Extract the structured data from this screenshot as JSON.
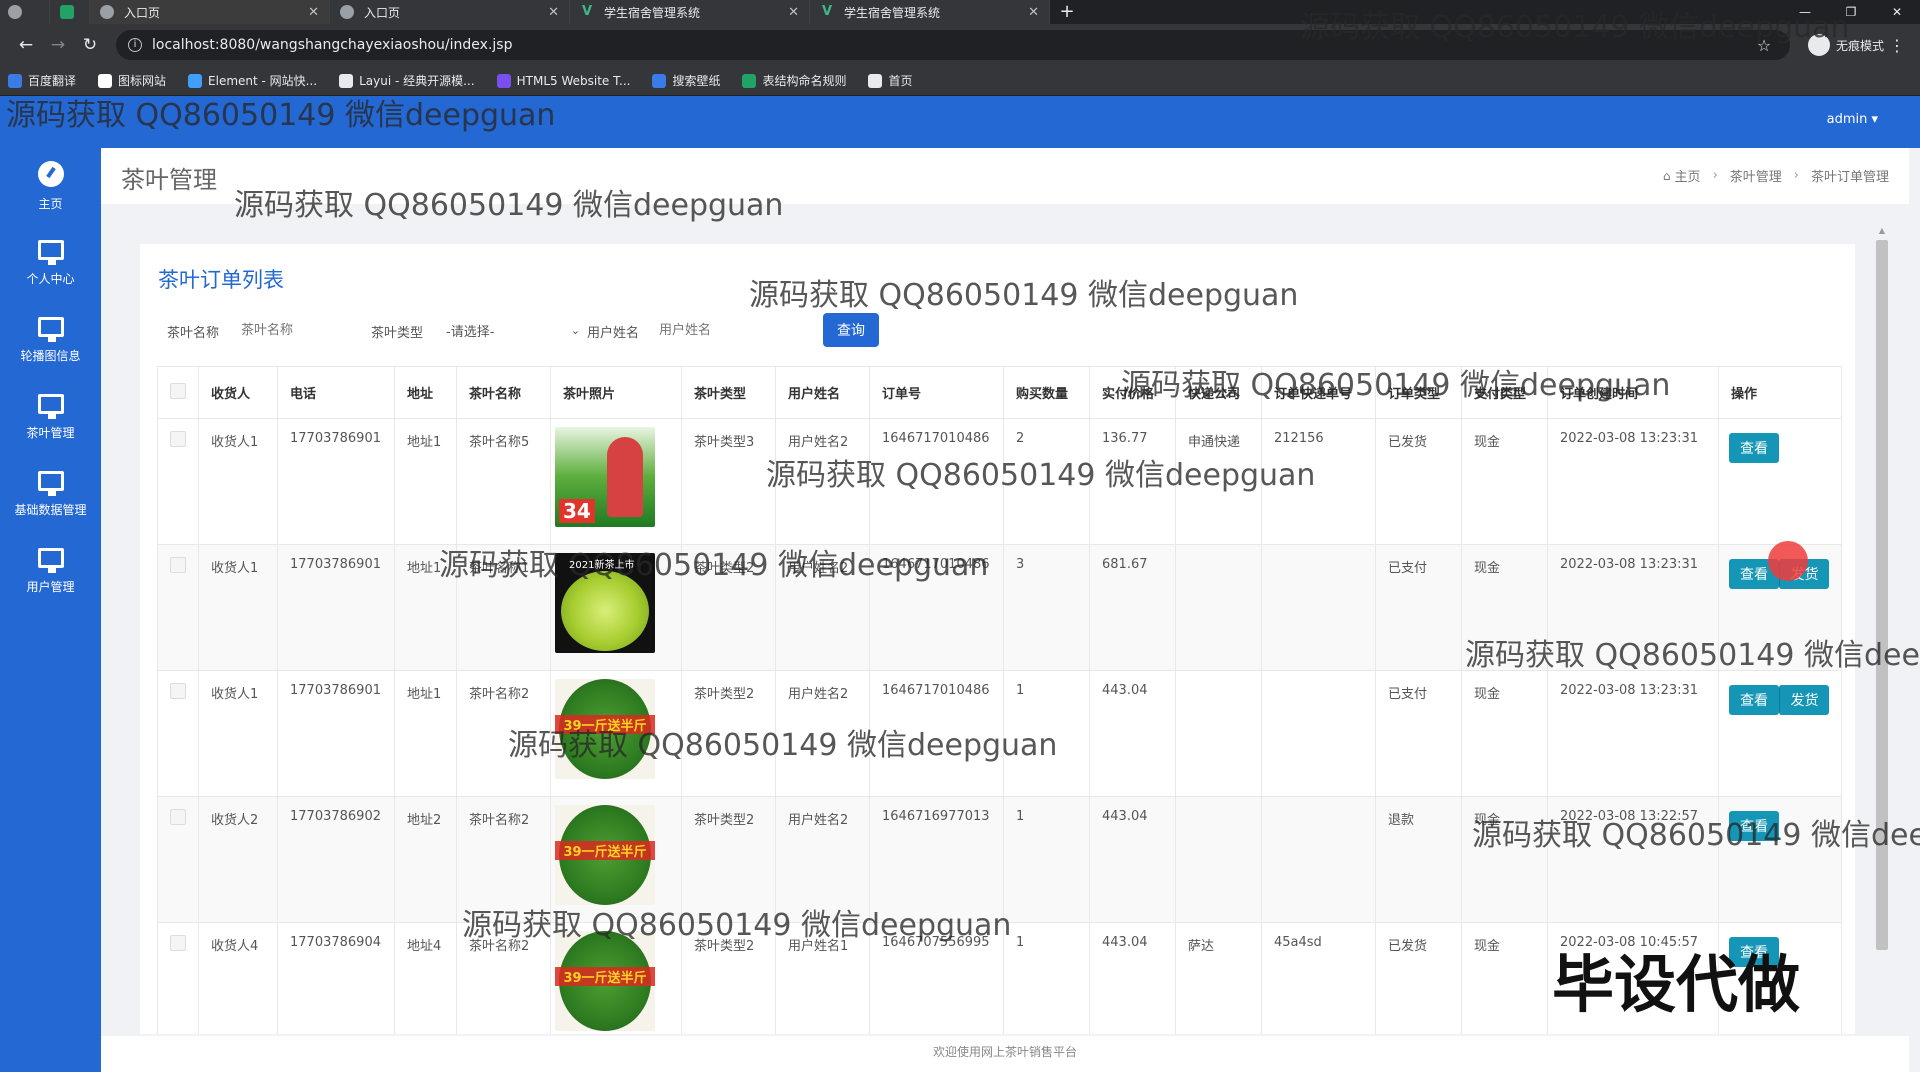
{
  "browser": {
    "tabs": [
      {
        "title": "入口页",
        "active": true,
        "icon": "globe-icon"
      },
      {
        "title": "入口页",
        "active": false,
        "icon": "globe-icon"
      },
      {
        "title": "学生宿舍管理系统",
        "active": false,
        "icon": "vue-icon"
      },
      {
        "title": "学生宿舍管理系统",
        "active": false,
        "icon": "vue-icon"
      }
    ],
    "new_tab": "+",
    "url": "localhost:8080/wangshangchayexiaoshou/index.jsp",
    "incognito_label": "无痕模式",
    "bookmarks": [
      {
        "label": "百度翻译",
        "color": "#3b7be8"
      },
      {
        "label": "图标网站",
        "color": "#ffffff"
      },
      {
        "label": "Element - 网站快...",
        "color": "#409eff"
      },
      {
        "label": "Layui - 经典开源模...",
        "color": "#e8eaed"
      },
      {
        "label": "HTML5 Website T...",
        "color": "#7a4ff0"
      },
      {
        "label": "搜索壁纸",
        "color": "#3b7be8"
      },
      {
        "label": "表结构命名规则",
        "color": "#21a366"
      },
      {
        "label": "首页",
        "color": "#e8eaed"
      }
    ]
  },
  "app": {
    "user": "admin ▾",
    "sidebar": [
      {
        "label": "主页",
        "icon": "dashboard-icon"
      },
      {
        "label": "个人中心",
        "icon": "monitor-icon"
      },
      {
        "label": "轮播图信息",
        "icon": "monitor-icon"
      },
      {
        "label": "茶叶管理",
        "icon": "monitor-icon"
      },
      {
        "label": "基础数据管理",
        "icon": "monitor-icon"
      },
      {
        "label": "用户管理",
        "icon": "monitor-icon"
      }
    ],
    "page_title": "茶叶管理",
    "breadcrumb": [
      "主页",
      "茶叶管理",
      "茶叶订单管理"
    ],
    "panel_title": "茶叶订单列表",
    "search": {
      "tea_name_label": "茶叶名称",
      "tea_name_placeholder": "茶叶名称",
      "tea_type_label": "茶叶类型",
      "tea_type_value": "-请选择-",
      "user_name_label": "用户姓名",
      "user_name_placeholder": "用户姓名",
      "submit": "查询"
    },
    "columns": [
      "收货人",
      "电话",
      "地址",
      "茶叶名称",
      "茶叶照片",
      "茶叶类型",
      "用户姓名",
      "订单号",
      "购买数量",
      "实付价格",
      "快递公司",
      "订单快递单号",
      "订单类型",
      "支付类型",
      "订单创建时间",
      "操作"
    ],
    "rows": [
      {
        "receiver": "收货人1",
        "phone": "17703786901",
        "address": "地址1",
        "tea_name": "茶叶名称5",
        "photo": "ph-a",
        "tea_type": "茶叶类型3",
        "user": "用户姓名2",
        "order_no": "1646717010486",
        "qty": "2",
        "price": "136.77",
        "courier": "申通快递",
        "tracking": "212156",
        "order_type": "已发货",
        "pay_type": "现金",
        "created": "2022-03-08 13:23:31",
        "actions": [
          "查看"
        ]
      },
      {
        "receiver": "收货人1",
        "phone": "17703786901",
        "address": "地址1",
        "tea_name": "茶叶名称1",
        "photo": "ph-b",
        "tea_type": "茶叶类型2",
        "user": "用户姓名2",
        "order_no": "1646717010486",
        "qty": "3",
        "price": "681.67",
        "courier": "",
        "tracking": "",
        "order_type": "已支付",
        "pay_type": "现金",
        "created": "2022-03-08 13:23:31",
        "actions": [
          "查看",
          "发货"
        ]
      },
      {
        "receiver": "收货人1",
        "phone": "17703786901",
        "address": "地址1",
        "tea_name": "茶叶名称2",
        "photo": "ph-c",
        "tea_type": "茶叶类型2",
        "user": "用户姓名2",
        "order_no": "1646717010486",
        "qty": "1",
        "price": "443.04",
        "courier": "",
        "tracking": "",
        "order_type": "已支付",
        "pay_type": "现金",
        "created": "2022-03-08 13:23:31",
        "actions": [
          "查看",
          "发货"
        ]
      },
      {
        "receiver": "收货人2",
        "phone": "17703786902",
        "address": "地址2",
        "tea_name": "茶叶名称2",
        "photo": "ph-c",
        "tea_type": "茶叶类型2",
        "user": "用户姓名2",
        "order_no": "1646716977013",
        "qty": "1",
        "price": "443.04",
        "courier": "",
        "tracking": "",
        "order_type": "退款",
        "pay_type": "现金",
        "created": "2022-03-08 13:22:57",
        "actions": [
          "查看"
        ]
      },
      {
        "receiver": "收货人4",
        "phone": "17703786904",
        "address": "地址4",
        "tea_name": "茶叶名称2",
        "photo": "ph-c",
        "tea_type": "茶叶类型2",
        "user": "用户姓名1",
        "order_no": "1646707556995",
        "qty": "1",
        "price": "443.04",
        "courier": "萨达",
        "tracking": "45a4sd",
        "order_type": "已发货",
        "pay_type": "现金",
        "created": "2022-03-08 10:45:57",
        "actions": [
          "查看"
        ]
      }
    ],
    "footer": "欢迎使用网上茶叶销售平台"
  },
  "watermark": {
    "text": "源码获取 QQ86050149 微信deepguan",
    "big_text": "毕设代做"
  }
}
